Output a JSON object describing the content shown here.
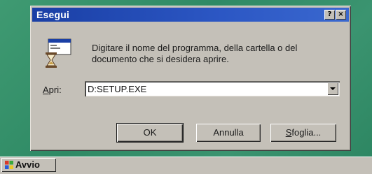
{
  "dialog": {
    "title": "Esegui",
    "help_button": "?",
    "close_button": "×",
    "prompt": "Digitare il nome del programma, della cartella o del documento che si desidera aprire.",
    "open_label_accel": "A",
    "open_label_rest": "pri:",
    "open_value": "D:SETUP.EXE",
    "ok_label": "OK",
    "cancel_label": "Annulla",
    "browse_label_accel": "S",
    "browse_label_rest": "foglia..."
  },
  "taskbar": {
    "start_label": "Avvio"
  },
  "icons": {
    "run": "run-program-icon",
    "start": "windows-logo-icon",
    "dropdown": "chevron-down-icon"
  },
  "colors": {
    "titlebar": "#1a3fa5",
    "desktop": "#2e8c66",
    "face": "#c4c0b8"
  }
}
